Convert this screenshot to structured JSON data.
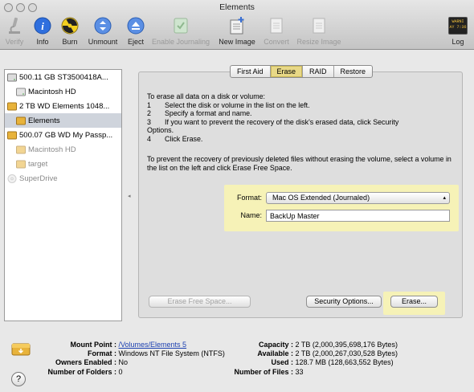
{
  "window": {
    "title": "Elements"
  },
  "toolbar": {
    "verify": "Verify",
    "info": "Info",
    "burn": "Burn",
    "unmount": "Unmount",
    "eject": "Eject",
    "enable_journaling": "Enable Journaling",
    "new_image": "New Image",
    "convert": "Convert",
    "resize_image": "Resize Image",
    "log": "Log",
    "log_icon_text_top": "WARNI",
    "log_icon_text_bottom": "AY 7:36"
  },
  "sidebar": {
    "items": [
      {
        "label": "500.11 GB ST3500418A...",
        "level": 0,
        "kind": "disk"
      },
      {
        "label": "Macintosh HD",
        "level": 1,
        "kind": "volume"
      },
      {
        "label": "2 TB WD Elements 1048...",
        "level": 0,
        "kind": "disk-ext"
      },
      {
        "label": "Elements",
        "level": 1,
        "kind": "volume-ext",
        "selected": true
      },
      {
        "label": "500.07 GB WD My Passp...",
        "level": 0,
        "kind": "disk-ext"
      },
      {
        "label": "Macintosh HD",
        "level": 1,
        "kind": "volume-ext",
        "dim": true
      },
      {
        "label": "target",
        "level": 1,
        "kind": "volume-ext",
        "dim": true
      },
      {
        "label": "SuperDrive",
        "level": 0,
        "kind": "optical",
        "dim": true
      }
    ]
  },
  "tabs": [
    "First Aid",
    "Erase",
    "RAID",
    "Restore"
  ],
  "active_tab": "Erase",
  "erase": {
    "intro": "To erase all data on a disk or volume:",
    "steps": [
      {
        "num": "1",
        "text": "Select the disk or volume in the list on the left."
      },
      {
        "num": "2",
        "text": "Specify a format and name."
      },
      {
        "num": "3",
        "text": "If you want to prevent the recovery of the disk's erased data, click Security"
      },
      {
        "num": "",
        "text": "Options."
      },
      {
        "num": "4",
        "text": "Click Erase."
      }
    ],
    "prevent_text": "To prevent the recovery of previously deleted files without erasing the volume, select a volume in the list on the left and click Erase Free Space.",
    "format_label": "Format:",
    "format_value": "Mac OS Extended (Journaled)",
    "name_label": "Name:",
    "name_value": "BackUp Master",
    "erase_free_space": "Erase Free Space...",
    "security_options": "Security Options...",
    "erase_button": "Erase..."
  },
  "info": {
    "mount_point_label": "Mount Point :",
    "mount_point_value": "/Volumes/Elements 5",
    "format_label": "Format :",
    "format_value": "Windows NT File System (NTFS)",
    "owners_label": "Owners Enabled :",
    "owners_value": "No",
    "folders_label": "Number of Folders :",
    "folders_value": "0",
    "capacity_label": "Capacity :",
    "capacity_value": "2 TB (2,000,395,698,176 Bytes)",
    "available_label": "Available :",
    "available_value": "2 TB (2,000,267,030,528 Bytes)",
    "used_label": "Used :",
    "used_value": "128.7 MB (128,663,552 Bytes)",
    "files_label": "Number of Files :",
    "files_value": "33",
    "help_symbol": "?"
  },
  "colors": {
    "highlight": "#f6f2b7",
    "active_tab": "#e8d886",
    "selection": "#cfd4dc"
  }
}
